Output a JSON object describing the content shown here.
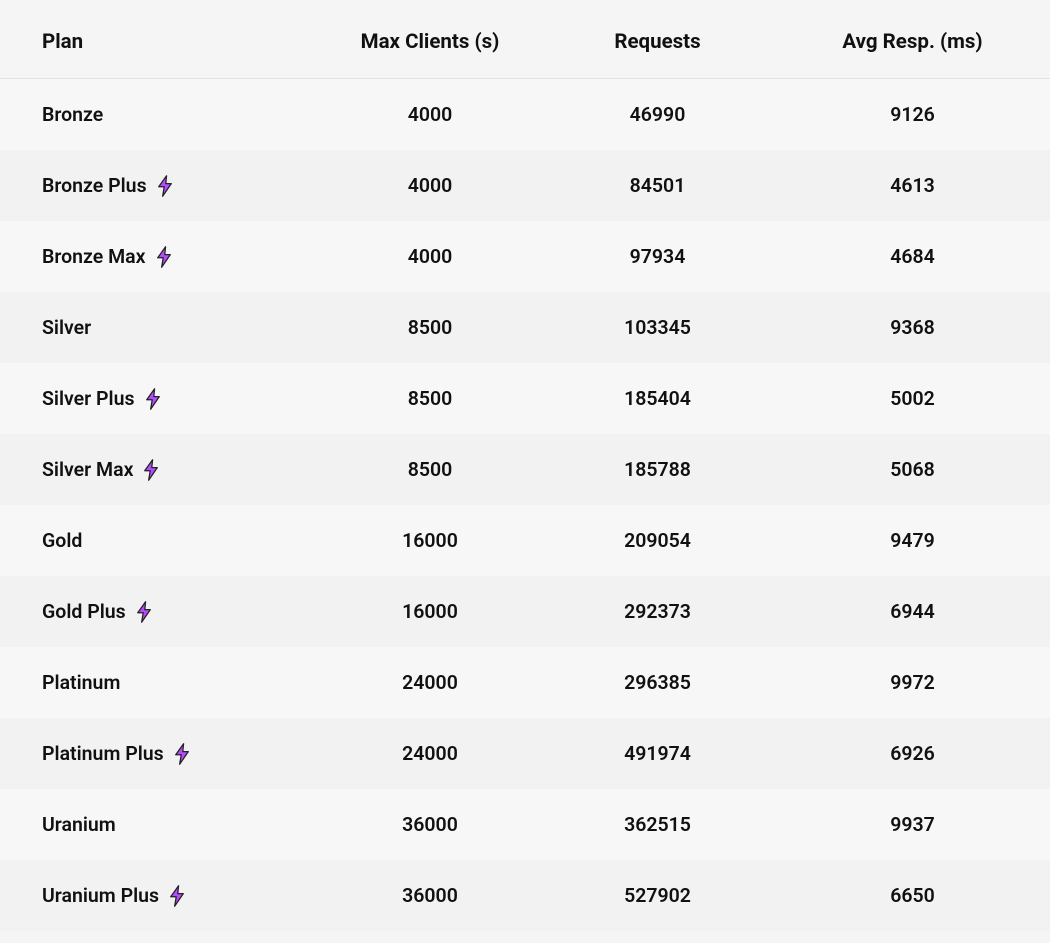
{
  "table": {
    "headers": {
      "plan": "Plan",
      "max_clients": "Max Clients (s)",
      "requests": "Requests",
      "avg_resp": "Avg Resp. (ms)"
    },
    "rows": [
      {
        "plan": "Bronze",
        "bolt": false,
        "max_clients": "4000",
        "requests": "46990",
        "avg_resp": "9126"
      },
      {
        "plan": "Bronze Plus",
        "bolt": true,
        "max_clients": "4000",
        "requests": "84501",
        "avg_resp": "4613"
      },
      {
        "plan": "Bronze Max",
        "bolt": true,
        "max_clients": "4000",
        "requests": "97934",
        "avg_resp": "4684"
      },
      {
        "plan": "Silver",
        "bolt": false,
        "max_clients": "8500",
        "requests": "103345",
        "avg_resp": "9368"
      },
      {
        "plan": "Silver Plus",
        "bolt": true,
        "max_clients": "8500",
        "requests": "185404",
        "avg_resp": "5002"
      },
      {
        "plan": "Silver Max",
        "bolt": true,
        "max_clients": "8500",
        "requests": "185788",
        "avg_resp": "5068"
      },
      {
        "plan": "Gold",
        "bolt": false,
        "max_clients": "16000",
        "requests": "209054",
        "avg_resp": "9479"
      },
      {
        "plan": "Gold Plus",
        "bolt": true,
        "max_clients": "16000",
        "requests": "292373",
        "avg_resp": "6944"
      },
      {
        "plan": "Platinum",
        "bolt": false,
        "max_clients": "24000",
        "requests": "296385",
        "avg_resp": "9972"
      },
      {
        "plan": "Platinum Plus",
        "bolt": true,
        "max_clients": "24000",
        "requests": "491974",
        "avg_resp": "6926"
      },
      {
        "plan": "Uranium",
        "bolt": false,
        "max_clients": "36000",
        "requests": "362515",
        "avg_resp": "9937"
      },
      {
        "plan": "Uranium Plus",
        "bolt": true,
        "max_clients": "36000",
        "requests": "527902",
        "avg_resp": "6650"
      }
    ]
  },
  "colors": {
    "bolt_fill": "#b54cff",
    "bolt_stroke": "#222"
  }
}
